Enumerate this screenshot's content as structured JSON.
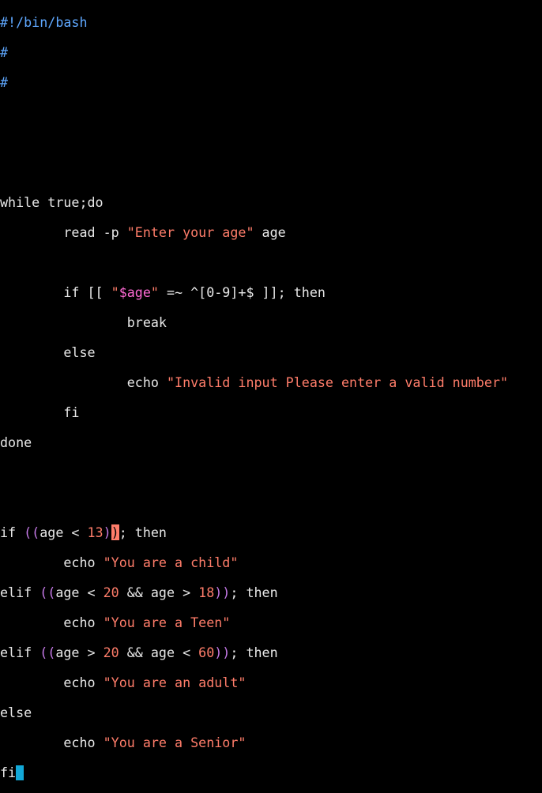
{
  "editor": {
    "lines": {
      "l01": "#!/bin/bash",
      "l02": "#",
      "l03": "#",
      "l07_kw": "while true;do",
      "l08_a": "        read -p ",
      "l08_s": "\"Enter your age\"",
      "l08_b": " age",
      "l10_a": "        if [[ ",
      "l10_q1": "\"",
      "l10_v": "$age",
      "l10_q2": "\"",
      "l10_b": " =~ ^[0-9]+$ ]]; then",
      "l11": "                break",
      "l12": "        else",
      "l13_a": "                echo ",
      "l13_s": "\"Invalid input Please enter a valid number\"",
      "l14": "        fi",
      "l15": "done",
      "l18_a": "if ",
      "l18_p1": "((",
      "l18_b": "age < ",
      "l18_n": "13",
      "l18_p2a": ")",
      "l18_p2b": ")",
      "l18_c": "; then",
      "l19_a": "        echo ",
      "l19_s": "\"You are a child\"",
      "l20_a": "elif ",
      "l20_p1": "((",
      "l20_b": "age < ",
      "l20_n1": "20",
      "l20_c": " && age > ",
      "l20_n2": "18",
      "l20_p2": "))",
      "l20_d": "; then",
      "l21_a": "        echo ",
      "l21_s": "\"You are a Teen\"",
      "l22_a": "elif ",
      "l22_p1": "((",
      "l22_b": "age > ",
      "l22_n1": "20",
      "l22_c": " && age < ",
      "l22_n2": "60",
      "l22_p2": "))",
      "l22_d": "; then",
      "l23_a": "        echo ",
      "l23_s": "\"You are an adult\"",
      "l24": "else",
      "l25_a": "        echo ",
      "l25_s": "\"You are a Senior\"",
      "l26": "fi"
    },
    "colors": {
      "background": "#000000",
      "text": "#e8e8e8",
      "comment": "#5fa8ff",
      "string": "#ff7d6a",
      "variable": "#ff6ad5",
      "paren": "#c67ae8",
      "cursor": "#12a8d8"
    }
  }
}
